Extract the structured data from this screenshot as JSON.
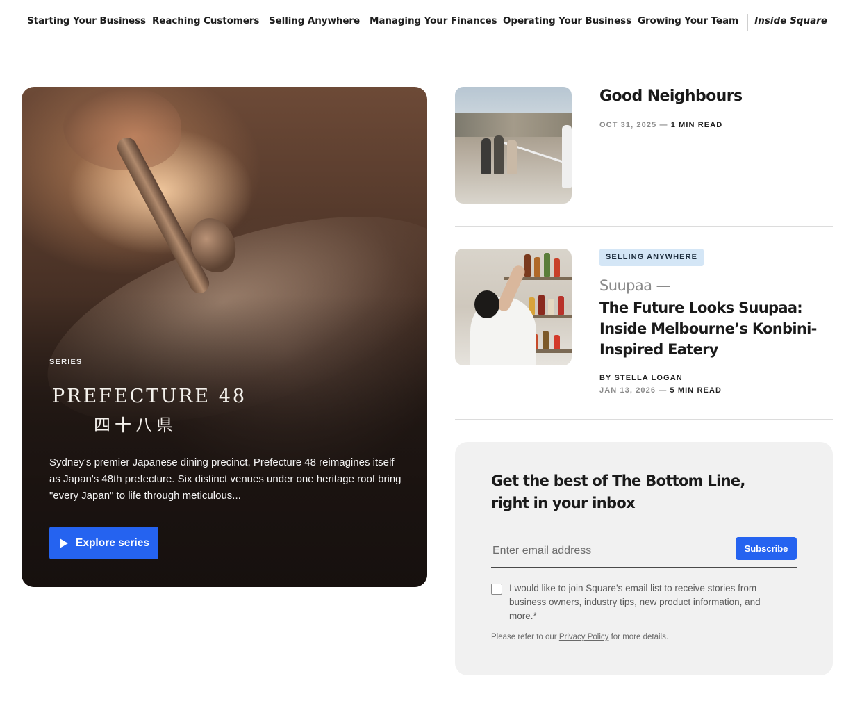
{
  "nav": {
    "items": [
      {
        "label": "Starting Your Business"
      },
      {
        "label": "Reaching Customers"
      },
      {
        "label": "Selling Anywhere"
      },
      {
        "label": "Managing Your Finances"
      },
      {
        "label": "Operating Your Business"
      },
      {
        "label": "Growing Your Team"
      }
    ],
    "inside_label": "Inside Square"
  },
  "hero": {
    "eyebrow": "SERIES",
    "logo_en": "PREFECTURE 48",
    "logo_jp": "四十八県",
    "description": "Sydney's premier Japanese dining precinct, Prefecture 48 reimagines itself as Japan's 48th prefecture. Six distinct venues under one heritage roof bring \"every Japan\" to life through meticulous...",
    "button_label": "Explore series",
    "button_icon": "play-icon"
  },
  "articles": [
    {
      "title": "Good Neighbours",
      "date": "OCT 31, 2025",
      "separator": " — ",
      "read_time": "1 MIN READ"
    },
    {
      "tag": "SELLING ANYWHERE",
      "kicker": "Suupaa —",
      "title": "The Future Looks Suupaa: Inside Melbourne’s Konbini-Inspired Eatery",
      "byline": "BY STELLA LOGAN",
      "date": "JAN 13, 2026",
      "separator": " — ",
      "read_time": "5 MIN READ"
    }
  ],
  "newsletter": {
    "title": "Get the best of The Bottom Line, right in your inbox",
    "email_placeholder": "Enter email address",
    "email_value": "",
    "subscribe_label": "Subscribe",
    "consent_text": "I would like to join Square’s email list to receive stories from business owners, industry tips, new product information, and more.*",
    "privacy_prefix": "Please refer to our ",
    "privacy_link": "Privacy Policy",
    "privacy_suffix": " for more details."
  },
  "colors": {
    "accent_blue": "#2563f0",
    "tag_bg": "#d4e6f6",
    "panel_bg": "#f1f1f1"
  }
}
